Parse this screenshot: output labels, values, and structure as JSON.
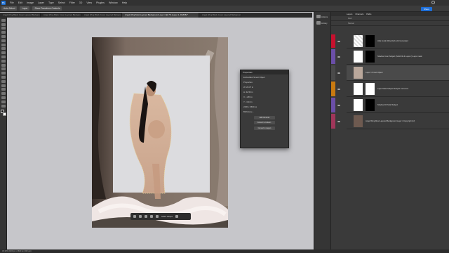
{
  "menubar": {
    "logo": "Ps",
    "items": [
      "File",
      "Edit",
      "Image",
      "Layer",
      "Type",
      "Select",
      "Filter",
      "3D",
      "View",
      "Plugins",
      "Window",
      "Help"
    ]
  },
  "options": {
    "auto_select": "Auto-Select",
    "layer": "Layer",
    "transform": "Show Transform Controls",
    "share": "Share"
  },
  "tabs": [
    {
      "label": "Angel Wing Black Cover Layered Background 1.psd",
      "active": false
    },
    {
      "label": "Angel Wing Black Cover Layered Background 2.psd",
      "active": false
    },
    {
      "label": "Angel Wing Black Cover Layered Background 3.psd",
      "active": false
    },
    {
      "label": "Angel Wing Most Layered Background Layer 4 @ 7% (Layer 1, RGB/8) *",
      "active": true
    },
    {
      "label": "Angel Wing Black Cover Layered Background 5.psd",
      "active": false
    }
  ],
  "status": "33.33%   2400 px x 3600 px (300 ppi)",
  "properties": {
    "title": "Properties",
    "object": "Embedded Smart Object",
    "section": "Properties",
    "w": "W: 28.37 in",
    "h": "H: 42.56 in",
    "x": "X: -1.86 in",
    "y": "Y: -3.44 in",
    "dim": "2400 x 3600 px",
    "file": "Birthstone...",
    "edit": "Edit Contents",
    "convert": "Convert to Linked...",
    "layers": "Convert to Layers"
  },
  "context": {
    "label": "Select subject"
  },
  "sidebar": {
    "item1": "Actions",
    "item2": "Library"
  },
  "layers_panel": {
    "tab1": "Layers",
    "tab2": "Channels",
    "tab3": "Paths",
    "kind": "Kind",
    "blend": "Normal",
    "items": [
      {
        "name": "Hide Guide Wing Dark (AI) Generated",
        "tag": "#c8102e"
      },
      {
        "name": "Shadow Inner Subject (Solid Fill & Layer 2) Layer mask",
        "tag": "#6b4fa8"
      },
      {
        "name": "Layer 1 Smart Object",
        "tag": "#4a4a4a"
      },
      {
        "name": "Layer Mask Subject Subject Comment",
        "tag": "#c97a10"
      },
      {
        "name": "Shadow Fill Solid Subject",
        "tag": "#6b4fa8"
      },
      {
        "name": "Angel Wing Most Layered Background Layer 4 Copyright (AI)",
        "tag": "#a0365a"
      }
    ]
  }
}
